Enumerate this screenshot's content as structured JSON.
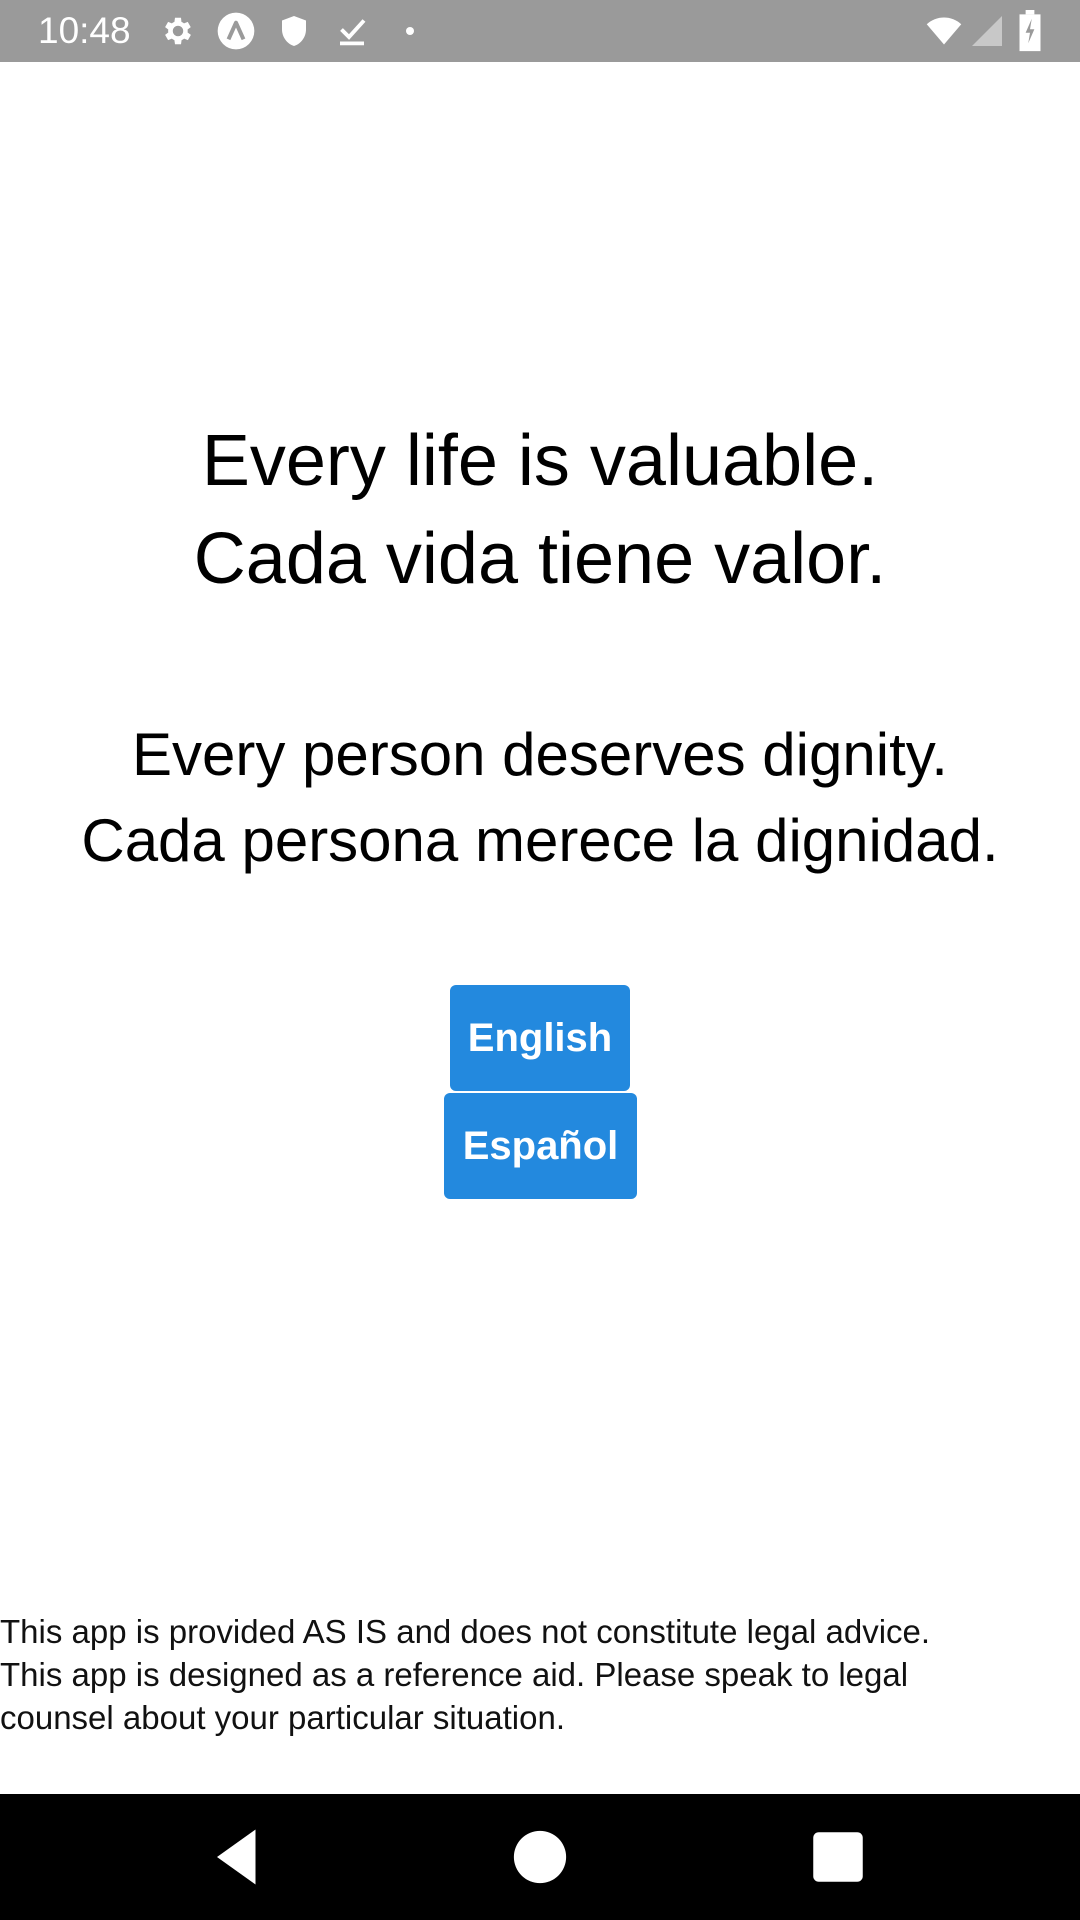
{
  "status_bar": {
    "time": "10:48",
    "icons": [
      "gear-icon",
      "app-a-icon",
      "shield-icon",
      "download-done-icon",
      "dot-icon",
      "wifi-icon",
      "cell-signal-icon",
      "battery-charging-icon"
    ],
    "color": "#9a9a9a"
  },
  "main": {
    "headline": {
      "english": "Every life is valuable.",
      "spanish": "Cada vida tiene valor."
    },
    "subline": {
      "english": "Every person deserves dignity.",
      "spanish": "Cada persona merece la dignidad."
    },
    "buttons": {
      "english_label": "English",
      "spanish_label": "Español",
      "color": "#2389de"
    },
    "disclaimer": {
      "line1": "This app is provided AS IS and does not constitute legal advice.",
      "line2": "This app is designed as a reference aid. Please speak to legal",
      "line3": "counsel about your particular situation."
    }
  },
  "nav_bar": {
    "icons": [
      "back-icon",
      "home-icon",
      "recents-icon"
    ]
  }
}
